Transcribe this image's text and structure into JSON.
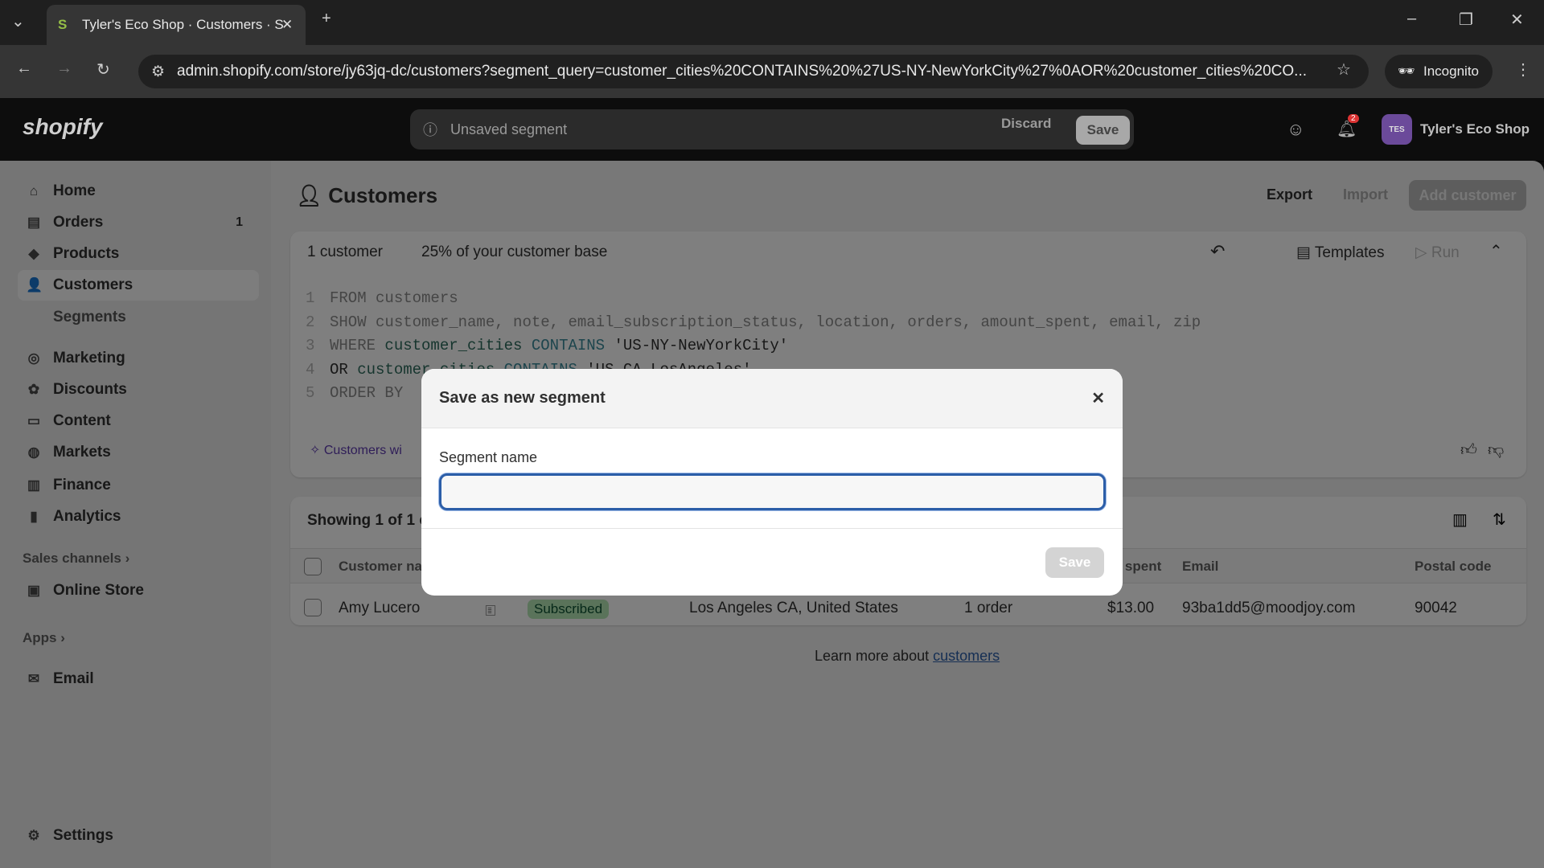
{
  "browser": {
    "tab_title": "Tyler's Eco Shop · Customers · S",
    "url": "admin.shopify.com/store/jy63jq-dc/customers?segment_query=customer_cities%20CONTAINS%20%27US-NY-NewYorkCity%27%0AOR%20customer_cities%20CO...",
    "incognito": "Incognito"
  },
  "topbar": {
    "logo": "shopify",
    "status": "Unsaved segment",
    "discard": "Discard",
    "save": "Save",
    "notif_count": "2",
    "avatar": "TES",
    "store": "Tyler's Eco Shop"
  },
  "sidebar": {
    "items": [
      {
        "label": "Home",
        "icon": "⌂"
      },
      {
        "label": "Orders",
        "icon": "▤",
        "badge": "1"
      },
      {
        "label": "Products",
        "icon": "◆"
      },
      {
        "label": "Customers",
        "icon": "👤"
      },
      {
        "label": "Segments"
      },
      {
        "label": "Marketing",
        "icon": "◎"
      },
      {
        "label": "Discounts",
        "icon": "✿"
      },
      {
        "label": "Content",
        "icon": "▭"
      },
      {
        "label": "Markets",
        "icon": "◍"
      },
      {
        "label": "Finance",
        "icon": "▥"
      },
      {
        "label": "Analytics",
        "icon": "▮"
      }
    ],
    "sales_channels": "Sales channels ›",
    "online_store": "Online Store",
    "apps": "Apps ›",
    "email": "Email",
    "settings": "Settings"
  },
  "page": {
    "title": "Customers",
    "export": "Export",
    "import": "Import",
    "add": "Add customer"
  },
  "segment": {
    "count": "1 customer",
    "percent": "25% of your customer base",
    "templates": "Templates",
    "run": "Run",
    "code": [
      [
        "1",
        "FROM customers"
      ],
      [
        "2",
        "SHOW customer_name, note, email_subscription_status, location, orders, amount_spent, email, zip"
      ],
      [
        "3",
        "WHERE",
        "customer_cities",
        "CONTAINS",
        "'US-NY-NewYorkCity'"
      ],
      [
        "4",
        "OR",
        "customer_cities",
        "CONTAINS",
        "'US-CA-LosAngeles'"
      ],
      [
        "5",
        "ORDER BY"
      ]
    ],
    "suggestion": "Customers wi"
  },
  "table": {
    "showing": "Showing 1 of 1 c",
    "headers": {
      "name": "Customer name",
      "spent": "Amount spent",
      "email": "Email",
      "zip": "Postal code"
    },
    "row": {
      "name": "Amy Lucero",
      "status": "Subscribed",
      "location": "Los Angeles CA, United States",
      "orders": "1 order",
      "spent": "$13.00",
      "email": "93ba1dd5@moodjoy.com",
      "zip": "90042"
    }
  },
  "footer": {
    "learn": "Learn more about ",
    "link": "customers"
  },
  "modal": {
    "title": "Save as new segment",
    "label": "Segment name",
    "value": "",
    "save": "Save"
  }
}
